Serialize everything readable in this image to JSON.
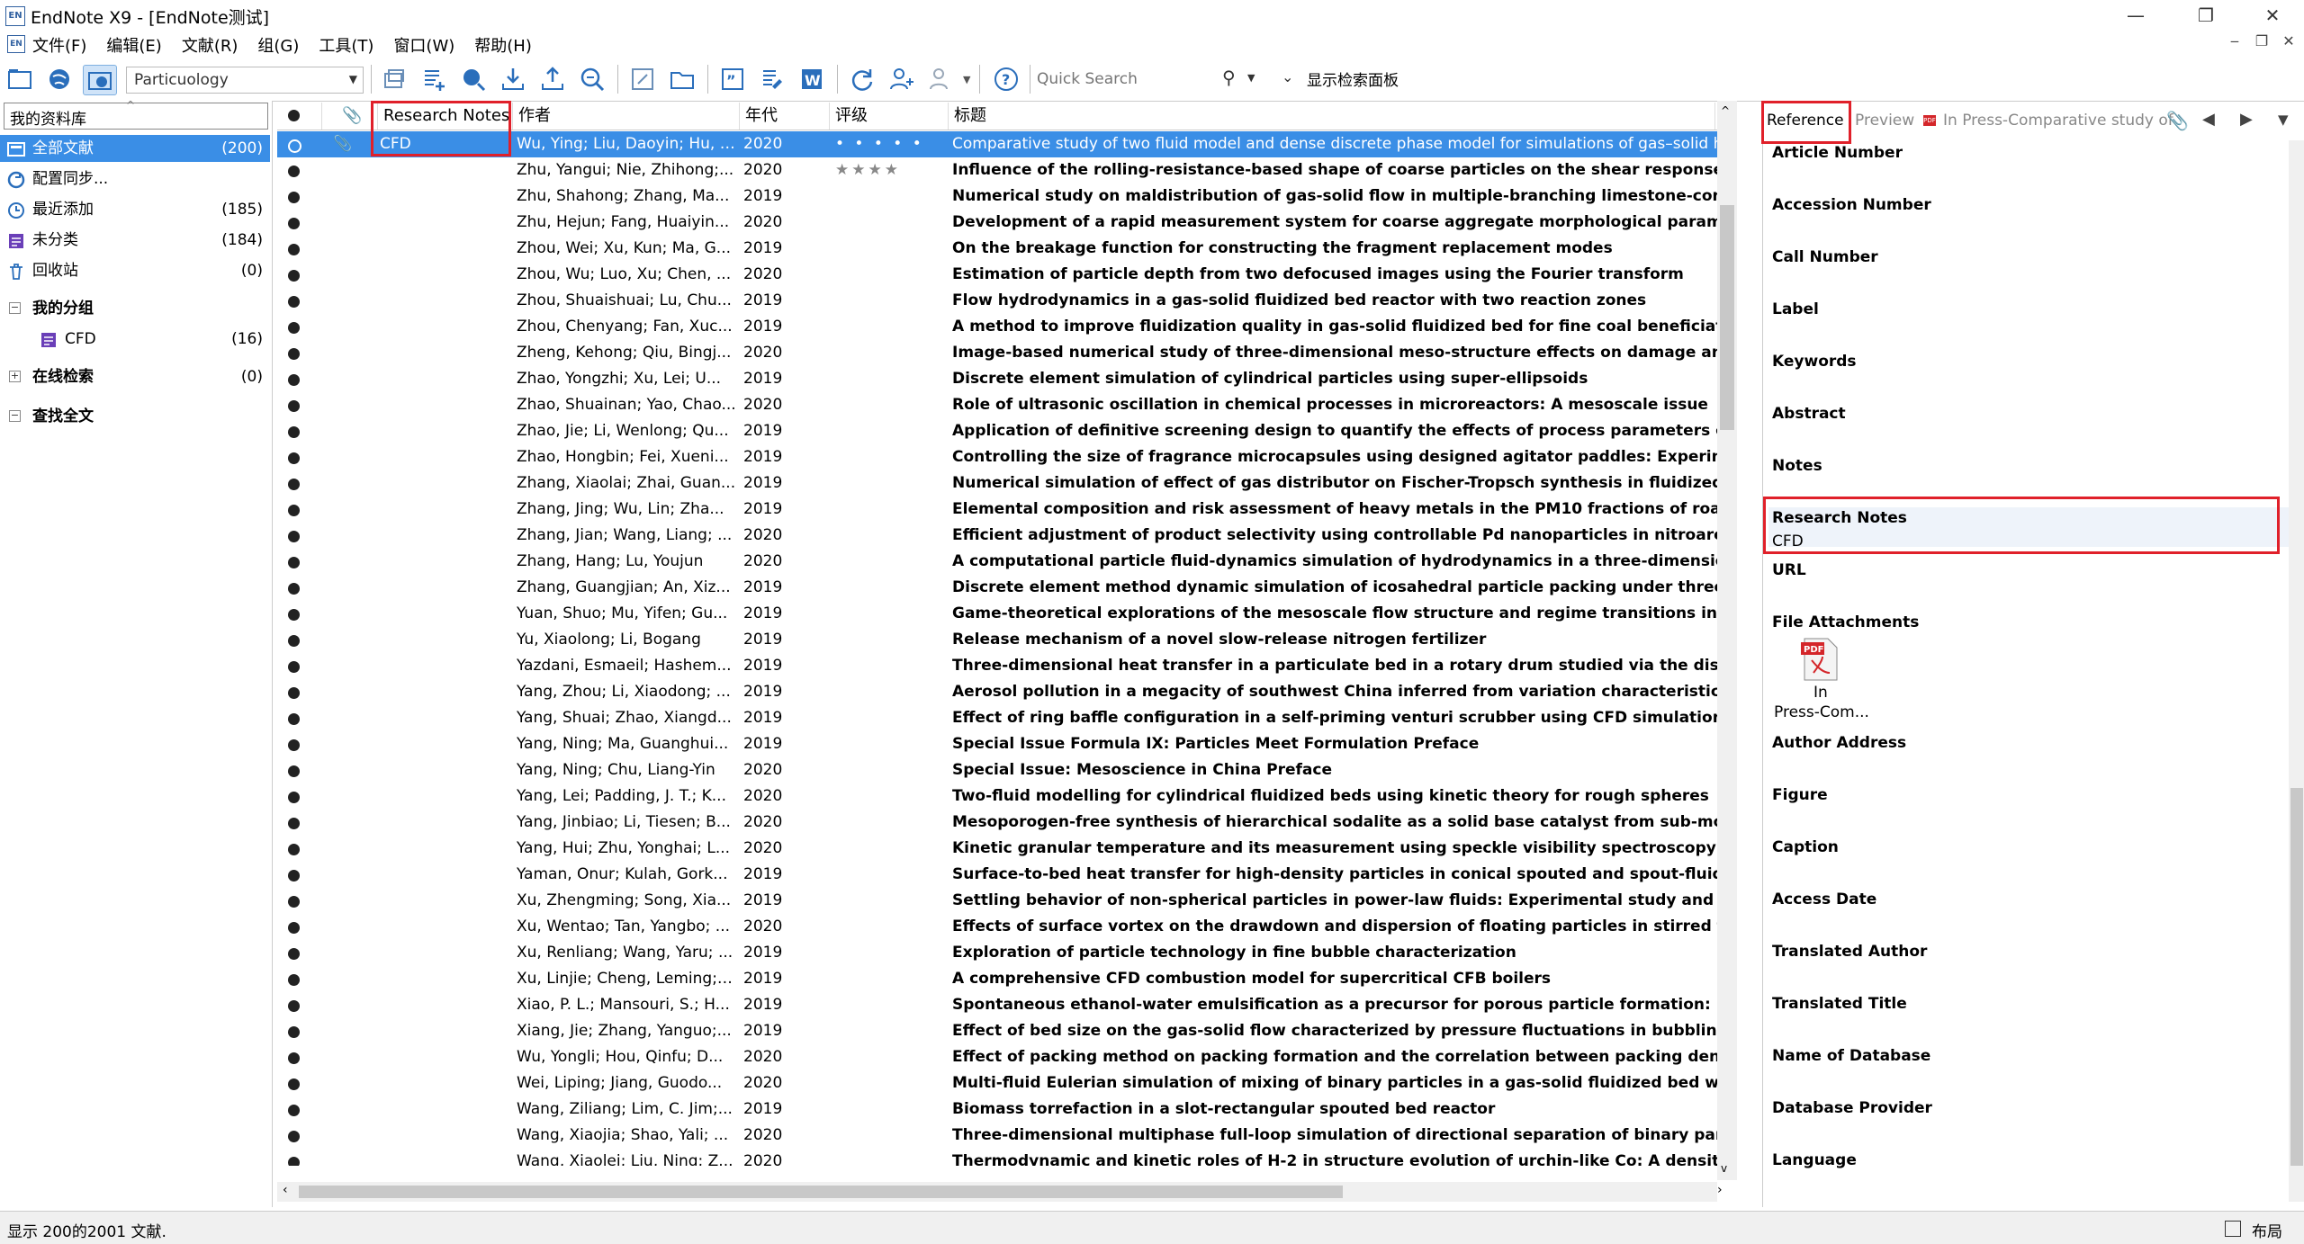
{
  "window": {
    "title": "EndNote X9 - [EndNote测试]",
    "app_icon": "EN",
    "controls": [
      "—",
      "❐",
      "✕"
    ]
  },
  "menu": {
    "items": [
      "文件(F)",
      "编辑(E)",
      "文献(R)",
      "组(G)",
      "工具(T)",
      "窗口(W)",
      "帮助(H)"
    ],
    "mdi_controls": [
      "‒",
      "❐",
      "✕"
    ]
  },
  "toolbar": {
    "style": "Particuology",
    "quick_search_placeholder": "Quick Search",
    "show_search_panel": "显示检索面板"
  },
  "library": {
    "header": "我的资料库",
    "groups": [
      {
        "label": "全部文献",
        "count": "(200)",
        "icon": "library-icon",
        "selected": true
      },
      {
        "label": "配置同步...",
        "count": "",
        "icon": "sync-icon",
        "selected": false
      },
      {
        "label": "最近添加",
        "count": "(185)",
        "icon": "clock-icon",
        "selected": false
      },
      {
        "label": "未分类",
        "count": "(184)",
        "icon": "unfiled-icon",
        "selected": false
      },
      {
        "label": "回收站",
        "count": "(0)",
        "icon": "trash-icon",
        "selected": false
      }
    ],
    "my_groups": {
      "label": "我的分组",
      "items": [
        {
          "label": "CFD",
          "count": "(16)"
        }
      ]
    },
    "online_search": {
      "label": "在线检索",
      "count": "(0)"
    },
    "find_full_text": {
      "label": "查找全文"
    }
  },
  "list": {
    "columns": {
      "research_notes": "Research Notes",
      "author": "作者",
      "year": "年代",
      "rating": "评级",
      "title": "标题"
    },
    "rows": [
      {
        "rn": "CFD",
        "author": "Wu, Ying; Liu, Daoyin; Hu, Jin...",
        "year": "2020",
        "rating": "• • • • •",
        "title": "Comparative study of two fluid model and dense discrete phase model for simulations of gas–solid hydrodyn",
        "selected": true
      },
      {
        "rn": "",
        "author": "Zhu, Yangui; Nie, Zhihong;...",
        "year": "2020",
        "rating": "★★★★",
        "title": "Influence of the rolling-resistance-based shape of coarse particles on the shear responses of granular m"
      },
      {
        "rn": "",
        "author": "Zhu, Shahong; Zhang, Ma...",
        "year": "2019",
        "rating": "",
        "title": "Numerical study on maldistribution of gas-solid flow in multiple-branching limestone-conveying pipeli"
      },
      {
        "rn": "",
        "author": "Zhu, Hejun; Fang, Huaiyin...",
        "year": "2020",
        "rating": "",
        "title": "Development of a rapid measurement system for coarse aggregate morphological parameters"
      },
      {
        "rn": "",
        "author": "Zhou, Wei; Xu, Kun; Ma, G...",
        "year": "2019",
        "rating": "",
        "title": "On the breakage function for constructing the fragment replacement modes"
      },
      {
        "rn": "",
        "author": "Zhou, Wu; Luo, Xu; Chen, ...",
        "year": "2020",
        "rating": "",
        "title": "Estimation of particle depth from two defocused images using the Fourier transform"
      },
      {
        "rn": "",
        "author": "Zhou, Shuaishuai; Lu, Chu...",
        "year": "2019",
        "rating": "",
        "title": "Flow hydrodynamics in a gas-solid fluidized bed reactor with two reaction zones"
      },
      {
        "rn": "",
        "author": "Zhou, Chenyang; Fan, Xuc...",
        "year": "2019",
        "rating": "",
        "title": "A method to improve fluidization quality in gas-solid fluidized bed for fine coal beneficiation"
      },
      {
        "rn": "",
        "author": "Zheng, Kehong; Qiu, Bingj...",
        "year": "2020",
        "rating": "",
        "title": "Image-based numerical study of three-dimensional meso-structure effects on damage and failure of he"
      },
      {
        "rn": "",
        "author": "Zhao, Yongzhi; Xu, Lei; U...",
        "year": "2019",
        "rating": "",
        "title": "Discrete element simulation of cylindrical particles using super-ellipsoids"
      },
      {
        "rn": "",
        "author": "Zhao, Shuainan; Yao, Chao...",
        "year": "2020",
        "rating": "",
        "title": "Role of ultrasonic oscillation in chemical processes in microreactors: A mesoscale issue"
      },
      {
        "rn": "",
        "author": "Zhao, Jie; Li, Wenlong; Qu...",
        "year": "2019",
        "rating": "",
        "title": "Application of definitive screening design to quantify the effects of process parameters on key granula"
      },
      {
        "rn": "",
        "author": "Zhao, Hongbin; Fei, Xueni...",
        "year": "2019",
        "rating": "",
        "title": "Controlling the size of fragrance microcapsules using designed agitator paddles: Experiment and CFD s"
      },
      {
        "rn": "",
        "author": "Zhang, Xiaolai; Zhai, Guan...",
        "year": "2019",
        "rating": "",
        "title": "Numerical simulation of effect of gas distributor on Fischer-Tropsch synthesis in fluidized-bed reactor"
      },
      {
        "rn": "",
        "author": "Zhang, Jing; Wu, Lin; Zha...",
        "year": "2019",
        "rating": "",
        "title": "Elemental composition and risk assessment of heavy metals in the PM10 fractions of road dust and roa"
      },
      {
        "rn": "",
        "author": "Zhang, Jian; Wang, Liang; ...",
        "year": "2020",
        "rating": "",
        "title": "Efficient adjustment of product selectivity using controllable Pd nanoparticles in nitroarene hydrogena"
      },
      {
        "rn": "",
        "author": "Zhang, Hang; Lu, Youjun",
        "year": "2020",
        "rating": "",
        "title": "A computational particle fluid-dynamics simulation of hydrodynamics in a three-dimensional full-loop"
      },
      {
        "rn": "",
        "author": "Zhang, Guangjian; An, Xiz...",
        "year": "2019",
        "rating": "",
        "title": "Discrete element method dynamic simulation of icosahedral particle packing under three-dimensional"
      },
      {
        "rn": "",
        "author": "Yuan, Shuo; Mu, Yifen; Gu...",
        "year": "2019",
        "rating": "",
        "title": "Game-theoretical explorations of the mesoscale flow structure and regime transitions in bubble colum"
      },
      {
        "rn": "",
        "author": "Yu, Xiaolong; Li, Bogang",
        "year": "2019",
        "rating": "",
        "title": "Release mechanism of a novel slow-release nitrogen fertilizer"
      },
      {
        "rn": "",
        "author": "Yazdani, Esmaeil; Hashem...",
        "year": "2019",
        "rating": "",
        "title": "Three-dimensional heat transfer in a particulate bed in a rotary drum studied via the discrete element"
      },
      {
        "rn": "",
        "author": "Yang, Zhou; Li, Xiaodong; ...",
        "year": "2019",
        "rating": "",
        "title": "Aerosol pollution in a megacity of southwest China inferred from variation characteristics of sulfate-de"
      },
      {
        "rn": "",
        "author": "Yang, Shuai; Zhao, Xiangd...",
        "year": "2019",
        "rating": "",
        "title": "Effect of ring baffle configuration in a self-priming venturi scrubber using CFD simulations"
      },
      {
        "rn": "",
        "author": "Yang, Ning; Ma, Guanghui...",
        "year": "2019",
        "rating": "",
        "title": "Special Issue Formula IX: Particles Meet Formulation Preface"
      },
      {
        "rn": "",
        "author": "Yang, Ning; Chu, Liang-Yin",
        "year": "2020",
        "rating": "",
        "title": "Special Issue: Mesoscience in China Preface"
      },
      {
        "rn": "",
        "author": "Yang, Lei; Padding, J. T.; K...",
        "year": "2020",
        "rating": "",
        "title": "Two-fluid modelling for cylindrical fluidized beds using kinetic theory for rough spheres"
      },
      {
        "rn": "",
        "author": "Yang, Jinbiao; Li, Tiesen; B...",
        "year": "2020",
        "rating": "",
        "title": "Mesoporogen-free synthesis of hierarchical sodalite as a solid base catalyst from sub-molten salt-activ"
      },
      {
        "rn": "",
        "author": "Yang, Hui; Zhu, Yonghai; L...",
        "year": "2020",
        "rating": "",
        "title": "Kinetic granular temperature and its measurement using speckle visibility spectroscopy"
      },
      {
        "rn": "",
        "author": "Yaman, Onur; Kulah, Gork...",
        "year": "2019",
        "rating": "",
        "title": "Surface-to-bed heat transfer for high-density particles in conical spouted and spout-fluid beds"
      },
      {
        "rn": "",
        "author": "Xu, Zhengming; Song, Xia...",
        "year": "2019",
        "rating": "",
        "title": "Settling behavior of non-spherical particles in power-law fluids: Experimental study and model develop"
      },
      {
        "rn": "",
        "author": "Xu, Wentao; Tan, Yangbo; ...",
        "year": "2020",
        "rating": "",
        "title": "Effects of surface vortex on the drawdown and dispersion of floating particles in stirred tanks"
      },
      {
        "rn": "",
        "author": "Xu, Renliang; Wang, Yaru; ...",
        "year": "2019",
        "rating": "",
        "title": "Exploration of particle technology in fine bubble characterization"
      },
      {
        "rn": "",
        "author": "Xu, Linjie; Cheng, Leming; ...",
        "year": "2019",
        "rating": "",
        "title": "A comprehensive CFD combustion model for supercritical CFB boilers"
      },
      {
        "rn": "",
        "author": "Xiao, P. L.; Mansouri, S.; H...",
        "year": "2019",
        "rating": "",
        "title": "Spontaneous ethanol-water emulsification as a precursor for porous particle formation: Understanding"
      },
      {
        "rn": "",
        "author": "Xiang, Jie; Zhang, Yanguo;...",
        "year": "2019",
        "rating": "",
        "title": "Effect of bed size on the gas-solid flow characterized by pressure fluctuations in bubbling fluidized be"
      },
      {
        "rn": "",
        "author": "Wu, Yongli; Hou, Qinfu; D...",
        "year": "2020",
        "rating": "",
        "title": "Effect of packing method on packing formation and the correlation between packing density and inter"
      },
      {
        "rn": "",
        "author": "Wei, Liping; Jiang, Guodo...",
        "year": "2020",
        "rating": "",
        "title": "Multi-fluid Eulerian simulation of mixing of binary particles in a gas-solid fluidized bed with a cohesive"
      },
      {
        "rn": "",
        "author": "Wang, Ziliang; Lim, C. Jim;...",
        "year": "2019",
        "rating": "",
        "title": "Biomass torrefaction in a slot-rectangular spouted bed reactor"
      },
      {
        "rn": "",
        "author": "Wang, Xiaojia; Shao, Yali; ...",
        "year": "2020",
        "rating": "",
        "title": "Three-dimensional multiphase full-loop simulation of directional separation of binary particle mixture"
      },
      {
        "rn": "",
        "author": "Wang, Xiaolei; Liu, Ning; Z...",
        "year": "2020",
        "rating": "",
        "title": "Thermodynamic and kinetic roles of H-2 in structure evolution of urchin-like Co: A density functional t"
      }
    ]
  },
  "reference_panel": {
    "tabs": {
      "reference": "Reference",
      "preview": "Preview",
      "pdf": "In Press-Comparative study of"
    },
    "fields": [
      "Article Number",
      "Accession Number",
      "Call Number",
      "Label",
      "Keywords",
      "Abstract",
      "Notes"
    ],
    "research_notes": {
      "label": "Research Notes",
      "value": "CFD"
    },
    "url_label": "URL",
    "file_attachments": {
      "label": "File Attachments",
      "file_line1": "In",
      "file_line2": "Press-Com..."
    },
    "more_fields": [
      "Author Address",
      "Figure",
      "Caption",
      "Access Date",
      "Translated Author",
      "Translated Title",
      "Name of Database",
      "Database Provider",
      "Language"
    ]
  },
  "status": {
    "text": "显示 200的2001 文献.",
    "layout": "布局"
  },
  "colors": {
    "selection": "#3a8ee6",
    "highlight_box": "#e0202a"
  }
}
